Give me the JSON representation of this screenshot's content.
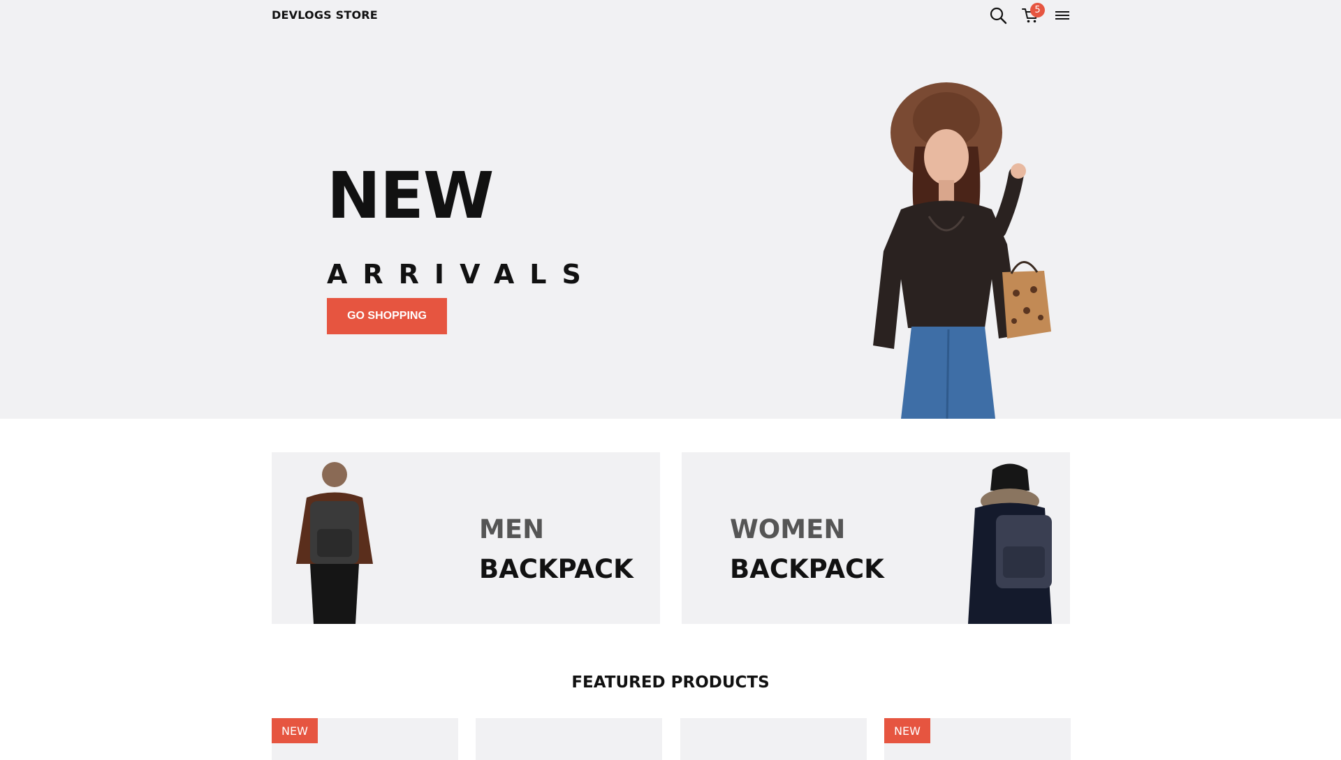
{
  "header": {
    "brand": "DEVLOGS STORE",
    "icons": [
      "search-icon",
      "cart-icon",
      "menu-icon"
    ],
    "cart_count": "5"
  },
  "hero": {
    "title": "NEW",
    "subtitle": "ARRIVALS",
    "cta_label": "GO SHOPPING"
  },
  "categories": [
    {
      "line1": "MEN",
      "line2": "BACKPACK"
    },
    {
      "line1": "WOMEN",
      "line2": "BACKPACK"
    }
  ],
  "featured": {
    "title": "FEATURED PRODUCTS",
    "products": [
      {
        "badge": "NEW"
      },
      {
        "badge": ""
      },
      {
        "badge": ""
      },
      {
        "badge": "NEW"
      }
    ]
  },
  "colors": {
    "accent": "#e65540",
    "hero_bg": "#f1f1f3",
    "text": "#111111"
  }
}
